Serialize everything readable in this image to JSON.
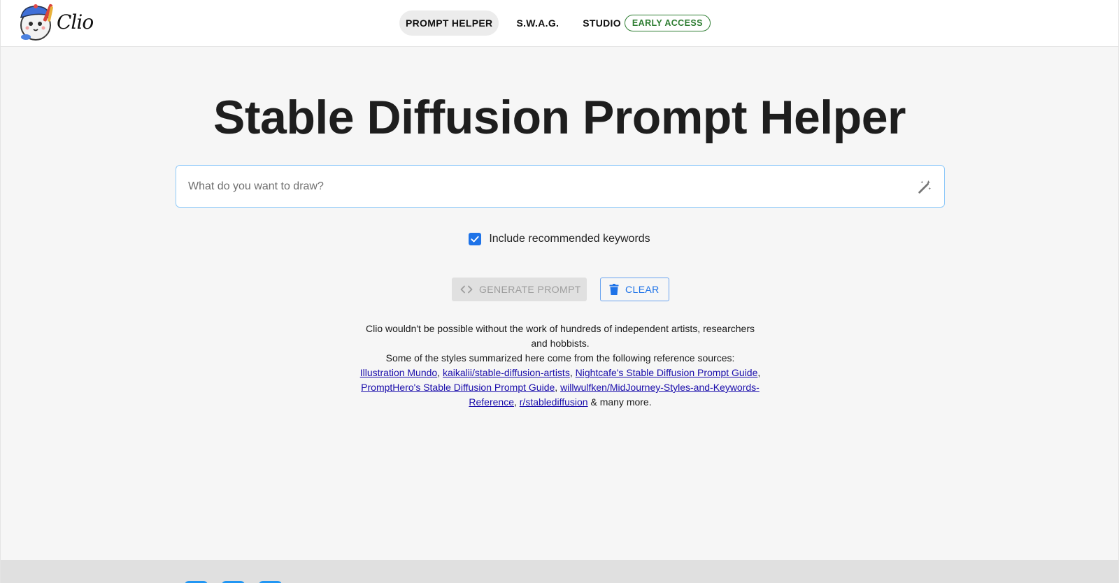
{
  "header": {
    "brand_name": "Clio",
    "nav": [
      {
        "label": "PROMPT HELPER",
        "active": true
      },
      {
        "label": "S.W.A.G.",
        "active": false
      },
      {
        "label": "STUDIO",
        "active": false,
        "badge": "EARLY ACCESS"
      }
    ]
  },
  "main": {
    "title": "Stable Diffusion Prompt Helper",
    "prompt_placeholder": "What do you want to draw?",
    "prompt_value": "",
    "wand_icon": "auto-fix-wand-icon",
    "include_keywords": {
      "label": "Include recommended keywords",
      "checked": true
    },
    "buttons": {
      "generate": {
        "label": "GENERATE PROMPT",
        "icon": "code-icon",
        "disabled": true
      },
      "clear": {
        "label": "CLEAR",
        "icon": "trash-icon"
      }
    },
    "credits": {
      "line1": "Clio wouldn't be possible without the work of hundreds of independent artists, researchers and hobbists.",
      "line2": "Some of the styles summarized here come from the following reference sources:",
      "links": [
        "Illustration Mundo",
        "kaikalii/stable-diffusion-artists",
        "Nightcafe's Stable Diffusion Prompt Guide",
        "PromptHero's Stable Diffusion Prompt Guide",
        "willwulfken/MidJourney-Styles-and-Keywords-Reference",
        "r/stablediffusion"
      ],
      "separator": ",",
      "suffix": "& many more."
    }
  },
  "colors": {
    "accent": "#1e73e8",
    "badge": "#2e7d32",
    "link": "#1a0dab",
    "main_bg": "#f6f6f6",
    "footer_bg": "#e0e0e0"
  }
}
